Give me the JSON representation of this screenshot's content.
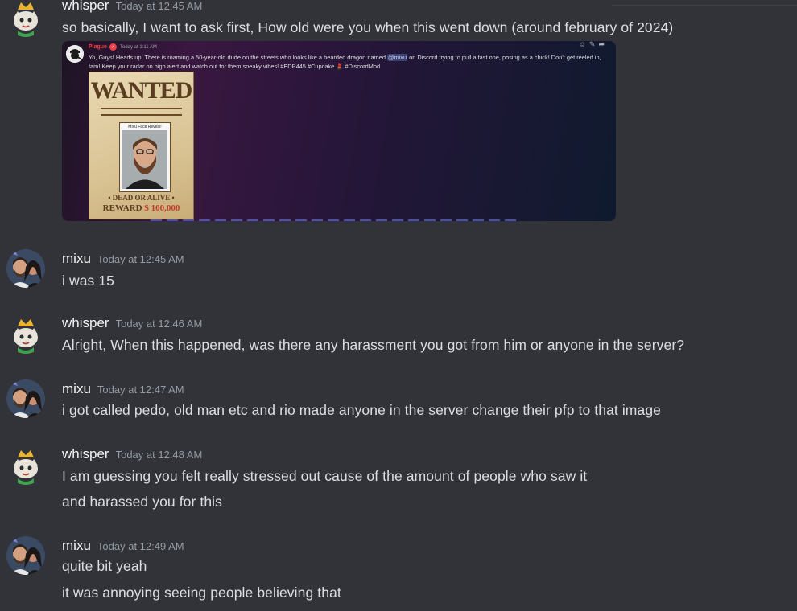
{
  "channel": {
    "messages": [
      {
        "username": "whisper",
        "timestamp": "Today at 12:45 AM",
        "avatar": "crowned-cat-avatar",
        "lines": [
          "so basically, I want to ask first, How old were you when this went down (around february of 2024)"
        ],
        "embed": {
          "author": "Plague",
          "timestamp": "Today at 1:11 AM",
          "text_before": "Yo, Guys! Heads up! There is roaming a 50-year-old dude on the streets who looks like a bearded dragon named ",
          "mention": "@mixu",
          "text_after": " on Discord trying to pull a fast one, posing as a chick! Don't get reeled in, fam! Keep your radar on high alert and watch out for them sneaky vibes! #EDP445 #Cupcake 💄 #DiscordMod",
          "poster": {
            "headline": "WANTED",
            "caption": "Mixu Face Reveal!",
            "dead_or_alive": "• DEAD OR ALIVE •",
            "reward_label": "REWARD",
            "reward_amount": "$ 100,000"
          }
        }
      },
      {
        "username": "mixu",
        "timestamp": "Today at 12:45 AM",
        "avatar": "couple-photo-avatar",
        "lines": [
          "i was 15"
        ]
      },
      {
        "username": "whisper",
        "timestamp": "Today at 12:46 AM",
        "avatar": "crowned-cat-avatar",
        "lines": [
          "Alright, When this happened, was there any harassment you got from him or anyone in the server?"
        ]
      },
      {
        "username": "mixu",
        "timestamp": "Today at 12:47 AM",
        "avatar": "couple-photo-avatar",
        "lines": [
          "i got called pedo, old man etc and rio made anyone in the server change their pfp to that image"
        ]
      },
      {
        "username": "whisper",
        "timestamp": "Today at 12:48 AM",
        "avatar": "crowned-cat-avatar",
        "lines": [
          "I am guessing you felt really stressed out cause of the amount of people who saw it",
          "and harassed you for this"
        ]
      },
      {
        "username": "mixu",
        "timestamp": "Today at 12:49 AM",
        "avatar": "couple-photo-avatar",
        "lines": [
          "quite bit yeah",
          "it was annoying seeing people believing that"
        ]
      }
    ]
  },
  "colors": {
    "background": "#313338",
    "username": "#f2f3f5",
    "timestamp": "#949ba4",
    "text": "#dbdee1",
    "embed_author": "#f23f43"
  }
}
